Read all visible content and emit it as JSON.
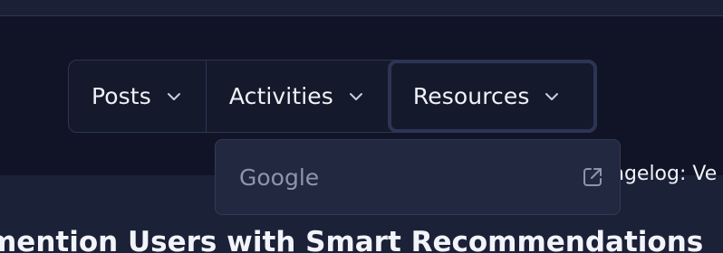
{
  "nav": {
    "items": [
      {
        "label": "Posts",
        "icon": "chevron-down-icon"
      },
      {
        "label": "Activities",
        "icon": "chevron-down-icon"
      },
      {
        "label": "Resources",
        "icon": "chevron-down-icon",
        "active": true
      }
    ]
  },
  "dropdown": {
    "items": [
      {
        "label": "Google",
        "icon": "external-link-icon"
      }
    ]
  },
  "background": {
    "changelog_text": "ngelog: Ve",
    "headline_text": "mention Users with Smart Recommendations"
  },
  "colors": {
    "page_background": "#131728",
    "nav_background": "#141a2c",
    "dropdown_background": "#212840",
    "border": "#2e3550",
    "text_primary": "#f0f2f8",
    "text_muted": "#8e95aa"
  }
}
